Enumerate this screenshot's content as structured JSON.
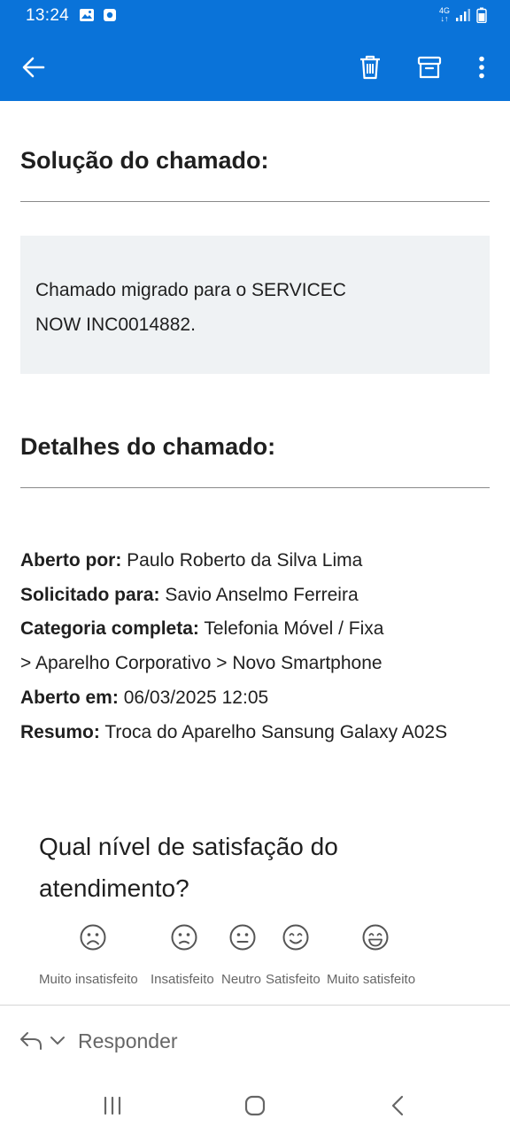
{
  "status_bar": {
    "time": "13:24",
    "network": "4G"
  },
  "toolbar": {
    "back_icon": "arrow-left-icon",
    "delete_icon": "trash-icon",
    "archive_icon": "archive-icon",
    "more_icon": "more-vertical-icon"
  },
  "email": {
    "solution_heading": "Solução do chamado:",
    "solution_text_line1": "Chamado migrado para o SERVICEC",
    "solution_text_line2": "NOW INC0014882.",
    "details_heading": "Detalhes do chamado:",
    "details": {
      "opened_by_label": "Aberto por:",
      "opened_by_value": " Paulo Roberto da Silva Lima",
      "requested_for_label": "Solicitado para:",
      "requested_for_value": " Savio Anselmo Ferreira",
      "category_label": "Categoria completa:",
      "category_value_line1": " Telefonia Móvel / Fixa",
      "category_value_line2": "> Aparelho Corporativo > Novo Smartphone",
      "opened_at_label": "Aberto em:",
      "opened_at_value": " 06/03/2025 12:05",
      "summary_label": "Resumo:",
      "summary_value": " Troca do Aparelho Sansung Galaxy A02S"
    },
    "survey": {
      "question_line1": "Qual nível de satisfação do",
      "question_line2": "atendimento?",
      "options": [
        {
          "label": "Muito insatisfeito",
          "icon": "very-dissatisfied-face-icon"
        },
        {
          "label": "Insatisfeito",
          "icon": "dissatisfied-face-icon"
        },
        {
          "label": "Neutro",
          "icon": "neutral-face-icon"
        },
        {
          "label": "Satisfeito",
          "icon": "satisfied-face-icon"
        },
        {
          "label": "Muito satisfeito",
          "icon": "very-satisfied-face-icon"
        }
      ]
    }
  },
  "reply_bar": {
    "label": "Responder",
    "icon": "reply-icon"
  },
  "colors": {
    "app_bar": "#0a73d9",
    "solution_box": "#eff2f4"
  }
}
